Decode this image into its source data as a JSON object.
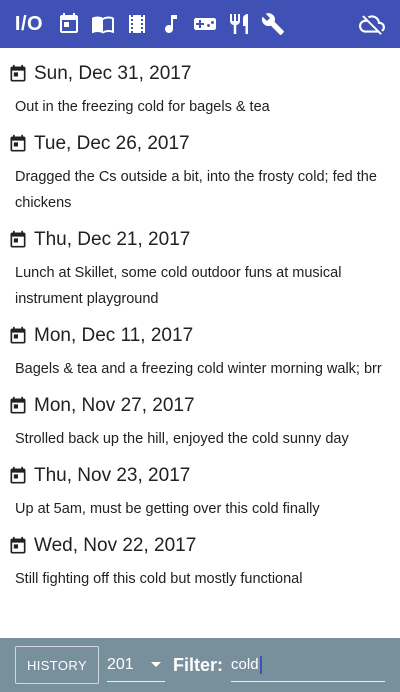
{
  "toolbar": {
    "io_label": "I/O",
    "icons": [
      "calendar-icon",
      "book-icon",
      "film-icon",
      "music-note-icon",
      "gamepad-icon",
      "fork-knife-icon",
      "wrench-icon",
      "cloud-off-icon"
    ],
    "background_color": "#3f51b5"
  },
  "entries": [
    {
      "date": "Sun, Dec 31, 2017",
      "text": "Out in the freezing cold for bagels & tea"
    },
    {
      "date": "Tue, Dec 26, 2017",
      "text": "Dragged the Cs outside a bit, into the frosty cold; fed the chickens"
    },
    {
      "date": "Thu, Dec 21, 2017",
      "text": "Lunch at Skillet, some cold outdoor funs at musical instrument playground"
    },
    {
      "date": "Mon, Dec 11, 2017",
      "text": "Bagels & tea and a freezing cold winter morning walk; brr"
    },
    {
      "date": "Mon, Nov 27, 2017",
      "text": "Strolled back up the hill, enjoyed the cold sunny day"
    },
    {
      "date": "Thu, Nov 23, 2017",
      "text": "Up at 5am, must be getting over this cold finally"
    },
    {
      "date": "Wed, Nov 22, 2017",
      "text": "Still fighting off this cold but mostly functional"
    }
  ],
  "bottombar": {
    "history_label": "HISTORY",
    "year_value": "201",
    "filter_label": "Filter:",
    "filter_value": "cold",
    "background_color": "#78909c"
  }
}
